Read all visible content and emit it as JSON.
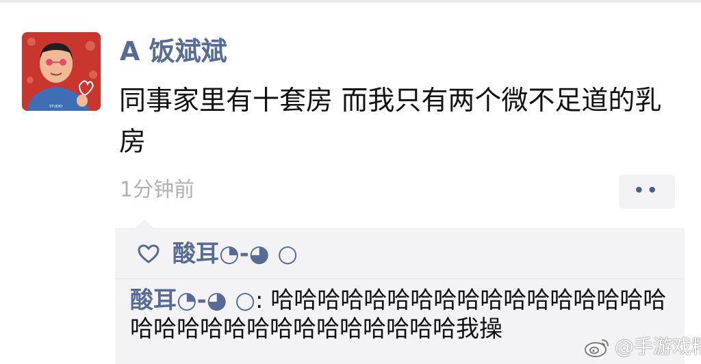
{
  "post": {
    "author": "A 饭斌斌",
    "content": "同事家里有十套房 而我只有两个微不足道的乳房",
    "time": "1分钟前",
    "more_label": "••"
  },
  "likes": {
    "icon": "heart-outline-icon",
    "users": "酸耳◔-◕ ○"
  },
  "comments": [
    {
      "user": "酸耳◔-◕ ○",
      "separator": ":",
      "text": " 哈哈哈哈哈哈哈哈哈哈哈哈哈哈哈哈哈哈哈哈哈哈哈哈哈哈哈哈哈哈哈我操"
    }
  ],
  "watermark": {
    "icon": "weibo-logo-icon",
    "text": "@手游戏精"
  },
  "colors": {
    "name_blue": "#576b95",
    "meta_gray": "#b2b2b2",
    "panel_bg": "#f3f3f5",
    "avatar_red": "#c8362e"
  }
}
